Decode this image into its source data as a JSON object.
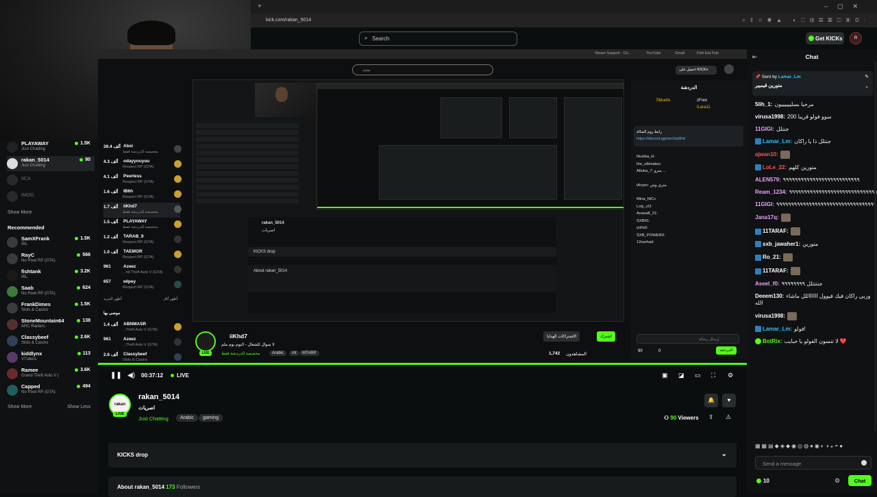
{
  "browser": {
    "url": "kick.com/rakan_5014"
  },
  "header": {
    "search_placeholder": "Search",
    "get_kicks": "Get KICKs",
    "avatar_initials": "R"
  },
  "sidebar": {
    "following": [
      {
        "name": "PLAYAWAY",
        "category": "Just Chatting",
        "viewers": "1.5K"
      },
      {
        "name": "rakan_5014",
        "category": "Just Chatting",
        "viewers": "90"
      },
      {
        "name": "IICA",
        "offline": true
      },
      {
        "name": "IMOD",
        "offline": true
      }
    ],
    "show_more_1": "Show More",
    "recommended_title": "Recommended",
    "recommended": [
      {
        "name": "SamXFrank",
        "category": "IRL",
        "viewers": "1.5K"
      },
      {
        "name": "RayC",
        "category": "No Pixel RP (GTA)",
        "viewers": "566"
      },
      {
        "name": "fishtank",
        "category": "IRL",
        "viewers": "3.2K"
      },
      {
        "name": "Saab",
        "category": "No Pixel RP (GTA)",
        "viewers": "624"
      },
      {
        "name": "FrankDimes",
        "category": "Slots & Casino",
        "viewers": "1.5K"
      },
      {
        "name": "StoneMountain64",
        "category": "ARC Raiders",
        "viewers": "138"
      },
      {
        "name": "Classybeef",
        "category": "Slots & Casino",
        "viewers": "2.6K"
      },
      {
        "name": "kiddlynx",
        "category": "VTubers",
        "viewers": "113"
      },
      {
        "name": "Ramee",
        "category": "Grand Theft Auto V (",
        "viewers": "3.6K"
      },
      {
        "name": "Capped",
        "category": "No Pixel RP (GTA)",
        "viewers": "494"
      }
    ],
    "show_more_2": "Show More",
    "show_less": "Show Less"
  },
  "nested": {
    "top_items": [
      "Steam Support - Ch...",
      "YouTube",
      "Gmail",
      "Fish Eat Fish"
    ],
    "search_placeholder": "بحث",
    "get_kicks": "احصل على KICKs",
    "sidebar": [
      {
        "viewers": "39.4 ألف",
        "name": "Absi",
        "category": "مخصصة للدردشة فقط"
      },
      {
        "viewers": "4.3 ألف",
        "name": "odayyouyou",
        "category": "Respect RP (GTA)"
      },
      {
        "viewers": "4.1 ألف",
        "name": "Peerless",
        "category": "Respect RP (GTA)"
      },
      {
        "viewers": "1.6 ألف",
        "name": "lB6h",
        "category": "Respect RP (GTA)"
      },
      {
        "viewers": "1.7 ألف",
        "name": "iiKhd7",
        "category": "مخصصة للدردشة فقط"
      },
      {
        "viewers": "1.5 ألف",
        "name": "PLAYAWAY",
        "category": "مخصصة للدردشة فقط"
      },
      {
        "viewers": "1.2 ألف",
        "name": "TARAB_9",
        "category": "Respect RP (GTA)"
      },
      {
        "viewers": "1.0 ألف",
        "name": "TAEMOR",
        "category": "Respect RP (GTA)"
      },
      {
        "viewers": "961",
        "name": "Azeez",
        "category": "...nd Theft Auto V (GTA)"
      },
      {
        "viewers": "657",
        "name": "wIpey",
        "category": "Respect RP (GTA)"
      }
    ],
    "show_more": "أظهر المزيد",
    "show_less": "أظهر أقل",
    "recommended": "موصى بها",
    "sidebar2": [
      {
        "viewers": "1.4 ألف",
        "name": "ABNMASR",
        "category": "...Theft Auto V (GTA)"
      },
      {
        "viewers": "961",
        "name": "Azeez",
        "category": "...Theft Auto V (GTA)"
      },
      {
        "viewers": "2.6 ألف",
        "name": "Classybeef",
        "category": "Slots & Casino"
      }
    ],
    "screen_streamer": "rakan_5014",
    "screen_title": "اصريات",
    "screen_drop": "KICKS drop",
    "screen_about": "About rakan_5014",
    "chat_title": "الدردشة",
    "chat_pinned_users": [
      "7lbluefa",
      "zFrex",
      "lLara11"
    ],
    "chat_pin_link": "https://discord.gg/zwnSw8Dd",
    "chat_pin_text": "رابط روم الصالة",
    "chat_msgs": [
      "Nusiba_H:",
      "the_ultimates:",
      "Altuka_7: مترو ...",
      "iAryen: متري وش",
      "Mina_NiCc",
      "Loly_zO:",
      "Anasa8_21:",
      "SXBII1:",
      "yollaS",
      "SXB_POWER0:",
      "12sarhad:"
    ],
    "chat_input": "إرسال رسالة",
    "chat_points": "90",
    "chat_zero": "0",
    "chat_send": "الدردشة",
    "streamer": "iiKhd7",
    "title": "لا سوال للشغال - اليوم يوم ملم",
    "category": "مخصصة للدردشة فقط",
    "tags": [
      "Arabic",
      "mt",
      "MTARP"
    ],
    "views": "1,742",
    "views_label": "المشاهدون",
    "follow_btn": "اشترك",
    "sub_btn": "الاشتراكات الهدايا",
    "live": "LIVE"
  },
  "player": {
    "time": "00:37:12",
    "live": "LIVE"
  },
  "stream": {
    "avatar_text": "rakan",
    "live_badge": "LIVE",
    "streamer": "rakan_5014",
    "title": "اصريات",
    "category": "Just Chatting",
    "tags": [
      "Arabic",
      "gaming"
    ],
    "viewers": "90",
    "viewers_label": "Viewers",
    "kicks_drop": "KICKS drop",
    "about_prefix": "About rakan_5014",
    "followers_count": "173",
    "followers_label": "Followers"
  },
  "chat": {
    "title": "Chat",
    "pinned_by_label": "Sent by",
    "pinned_by": "Lamar_Lm",
    "pinned_text": "متورين قيميير",
    "messages": [
      {
        "user": "5lih_1:",
        "color": "#ffffff",
        "text": "مرحبا بسلييييييون"
      },
      {
        "user": "virusa1998:",
        "color": "#ffffff",
        "text": "سوو فولو قريبا 200"
      },
      {
        "user": "11GIGI:",
        "color": "#f0a0ff",
        "text": "جنتلل"
      },
      {
        "user": "Lamar_Lm:",
        "color": "#2ec4ff",
        "text": "جنتلل ذا يا راكان",
        "badge": true
      },
      {
        "user": "ajwan10:",
        "color": "#ff5555",
        "text": "",
        "emote": true
      },
      {
        "user": "LoLe_22:",
        "color": "#ff5555",
        "text": "متورين كلهم",
        "badge": true
      },
      {
        "user": "ALEN579:",
        "color": "#f0a0ff",
        "text": "٩٩٩٩٩٩٩٩٩٩٩٩٩٩٩٩٩٩٩٩٩٩٩٩٩٩"
      },
      {
        "user": "Ream_1234:",
        "color": "#f0a0ff",
        "text": "٩٩٩٩٩٩٩٩٩٩٩٩٩٩٩٩٩٩٩٩٩٩٩٩٩٩٩٩٩٩٩٩٩٩٩٩٩٩"
      },
      {
        "user": "11GIGI:",
        "color": "#f0a0ff",
        "text": "٩٩٩٩٩٩٩٩٩٩٩٩٩٩٩٩٩٩٩٩٩٩٩٩٩٩٩٩٩٩٩٩٩٩"
      },
      {
        "user": "Jana17q:",
        "color": "#f0a0ff",
        "text": "",
        "emote": true
      },
      {
        "user": "11TARAF:",
        "color": "#ffffff",
        "text": "",
        "badge": true,
        "emote": true
      },
      {
        "user": "sxb_jawaher1:",
        "color": "#ffffff",
        "text": "متورين",
        "badge": true
      },
      {
        "user": "Ro_21:",
        "color": "#ffffff",
        "text": "",
        "badge": true,
        "emote": true
      },
      {
        "user": "11TARAF:",
        "color": "#ffffff",
        "text": "",
        "badge": true,
        "emote": true
      },
      {
        "user": "Aseel_f0:",
        "color": "#f0a0ff",
        "text": "جنتتتلل ٩٩٩٩٩٩٩٩"
      },
      {
        "user": "Deeem130:",
        "color": "#ffffff",
        "text": "وربي راكان فيك فيوول ااااااللل ماشاء الله"
      },
      {
        "user": "virusa1998:",
        "color": "#ffffff",
        "text": "",
        "emote": true
      },
      {
        "user": "Lamar_Lm:",
        "color": "#2ec4ff",
        "text": "فولو!",
        "badge": true
      },
      {
        "user": "BotRix:",
        "color": "#53fc18",
        "text": "لا تنسون الفولو يا حبايب ❤️",
        "badge": true
      }
    ],
    "input_placeholder": "Send a message",
    "points": "10",
    "send_label": "Chat"
  }
}
